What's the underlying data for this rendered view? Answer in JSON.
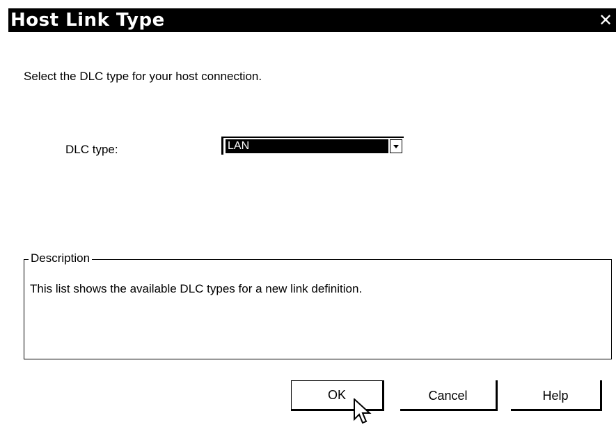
{
  "window": {
    "title": "Host Link Type",
    "close_glyph": "✕"
  },
  "instruction": "Select the DLC type for your host connection.",
  "dlc": {
    "label": "DLC type:",
    "selected": "LAN"
  },
  "description": {
    "legend": "Description",
    "text": "This list shows the available DLC types for a new link definition."
  },
  "buttons": {
    "ok": "OK",
    "cancel": "Cancel",
    "help": "Help"
  },
  "icons": {
    "close": "close-icon",
    "dropdown": "chevron-down-icon",
    "cursor": "mouse-pointer-icon"
  }
}
